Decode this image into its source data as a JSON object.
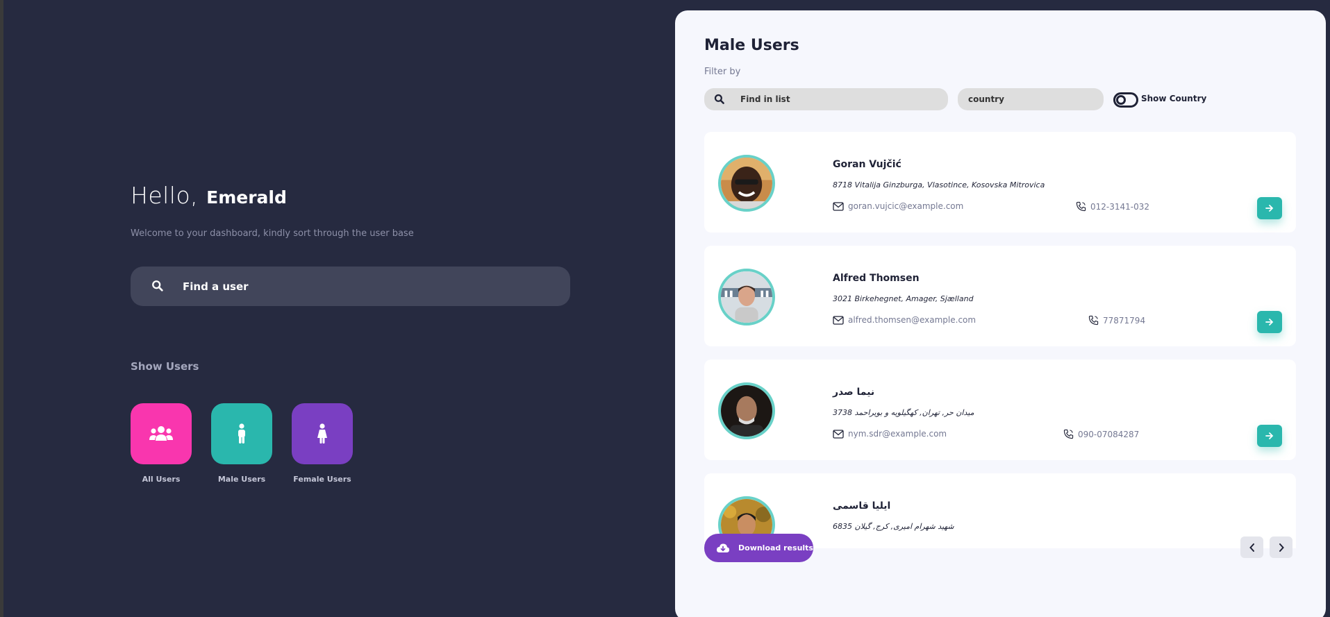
{
  "greeting": {
    "hello": "Hello,",
    "name": "Emerald",
    "welcome": "Welcome to your dashboard, kindly sort through the user base"
  },
  "search": {
    "placeholder": "Find a user"
  },
  "show_users": {
    "title": "Show Users",
    "tiles": [
      {
        "label": "All Users",
        "color": "#f936ae",
        "icon": "users-group-icon"
      },
      {
        "label": "Male Users",
        "color": "#2ab7ad",
        "icon": "male-icon"
      },
      {
        "label": "Female Users",
        "color": "#7a3fc2",
        "icon": "female-icon"
      }
    ]
  },
  "panel": {
    "title": "Male Users",
    "filter_label": "Filter by",
    "list_search_placeholder": "Find in list",
    "country_placeholder": "country",
    "toggle_label": "Show Country",
    "download_label": "Download results"
  },
  "users": [
    {
      "name": "Goran Vujčić",
      "address": "8718 Vitalija Ginzburga, Vlasotince, Kosovska Mitrovica",
      "email": "goran.vujcic@example.com",
      "phone": "012-3141-032"
    },
    {
      "name": "Alfred Thomsen",
      "address": "3021 Birkehegnet, Amager, Sjælland",
      "email": "alfred.thomsen@example.com",
      "phone": "77871794"
    },
    {
      "name": "نیما صدر",
      "address": "3738 میدان حر, تهران, کهگیلویه و بویراحمد",
      "email": "nym.sdr@example.com",
      "phone": "090-07084287"
    },
    {
      "name": "ایلیا قاسمی",
      "address": "6835 شهید شهرام امیری, کرج, گیلان",
      "email": "",
      "phone": ""
    }
  ],
  "colors": {
    "background": "#262a40",
    "panel": "#f6f7fd",
    "accent_teal": "#2ab7ad",
    "accent_purple": "#7a3fc2",
    "accent_pink": "#f936ae"
  }
}
